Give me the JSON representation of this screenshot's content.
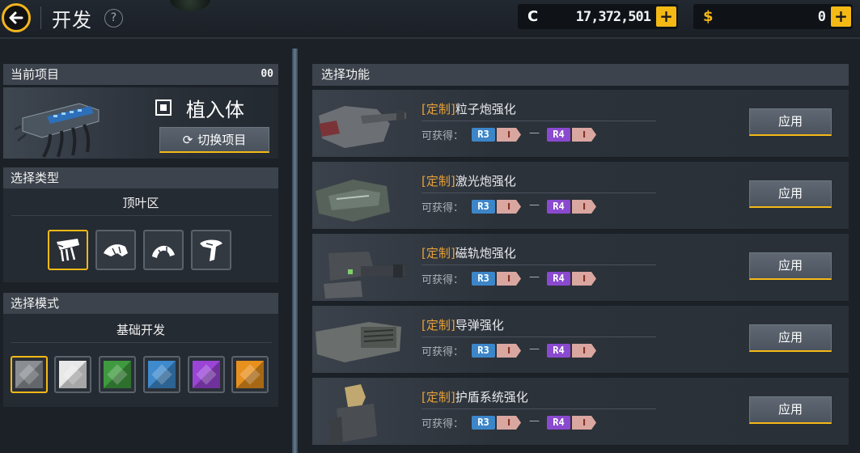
{
  "header": {
    "title": "开发",
    "help_symbol": "?",
    "currency_c": {
      "symbol": "C",
      "amount": "17,372,501",
      "color": "#ffffff"
    },
    "currency_s": {
      "symbol": "$",
      "amount": "0",
      "color": "#f5b916"
    },
    "plus_label": "+"
  },
  "project": {
    "header": "当前项目",
    "count": "00",
    "name": "植入体",
    "switch_label": "切换项目",
    "switch_icon": "refresh-icon"
  },
  "type_section": {
    "header": "选择类型",
    "selected_label": "顶叶区",
    "options": [
      {
        "icon": "implant-type-1-icon",
        "selected": true
      },
      {
        "icon": "implant-type-2-icon",
        "selected": false
      },
      {
        "icon": "implant-type-3-icon",
        "selected": false
      },
      {
        "icon": "implant-type-4-icon",
        "selected": false
      }
    ]
  },
  "mode_section": {
    "header": "选择模式",
    "selected_label": "基础开发",
    "modes": [
      {
        "color": "#8a8e93",
        "selected": true
      },
      {
        "color": "#e8e8e8",
        "selected": false
      },
      {
        "color": "#3f9a3f",
        "selected": false
      },
      {
        "color": "#3e8acc",
        "selected": false
      },
      {
        "color": "#9a45d6",
        "selected": false
      },
      {
        "color": "#e8901e",
        "selected": false
      }
    ]
  },
  "functions": {
    "header": "选择功能",
    "items": [
      {
        "tag": "[定制]",
        "name": "粒子炮强化",
        "obtain": "可获得：",
        "rank_from": "R3",
        "tier_from": "I",
        "dash": "—",
        "rank_to": "R4",
        "tier_to": "I",
        "apply": "应用"
      },
      {
        "tag": "[定制]",
        "name": "激光炮强化",
        "obtain": "可获得：",
        "rank_from": "R3",
        "tier_from": "I",
        "dash": "—",
        "rank_to": "R4",
        "tier_to": "I",
        "apply": "应用"
      },
      {
        "tag": "[定制]",
        "name": "磁轨炮强化",
        "obtain": "可获得：",
        "rank_from": "R3",
        "tier_from": "I",
        "dash": "—",
        "rank_to": "R4",
        "tier_to": "I",
        "apply": "应用"
      },
      {
        "tag": "[定制]",
        "name": "导弹强化",
        "obtain": "可获得：",
        "rank_from": "R3",
        "tier_from": "I",
        "dash": "—",
        "rank_to": "R4",
        "tier_to": "I",
        "apply": "应用"
      },
      {
        "tag": "[定制]",
        "name": "护盾系统强化",
        "obtain": "可获得：",
        "rank_from": "R3",
        "tier_from": "I",
        "dash": "—",
        "rank_to": "R4",
        "tier_to": "I",
        "apply": "应用"
      }
    ]
  }
}
